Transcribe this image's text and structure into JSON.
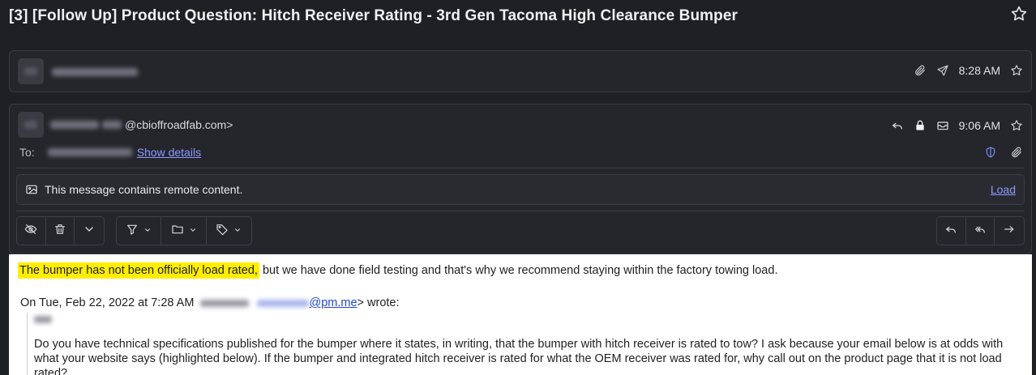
{
  "subject": "[3] [Follow Up] Product Question: Hitch Receiver Rating - 3rd Gen Tacoma High Clearance Bumper",
  "collapsed_message": {
    "time": "8:28 AM"
  },
  "expanded_message": {
    "sender_email_suffix": "@cbioffroadfab.com>",
    "time": "9:06 AM",
    "to_label": "To:",
    "show_details": "Show details"
  },
  "remote_content": {
    "text": "This message contains remote content.",
    "load_label": "Load"
  },
  "body": {
    "highlighted": "The bumper has not been officially load rated,",
    "rest": " but we have done field testing and that's why we recommend staying within the factory towing load.",
    "wrote_prefix": "On Tue, Feb 22, 2022 at 7:28 AM",
    "wrote_email": "@pm.me",
    "wrote_suffix": "> wrote:",
    "quote_text": "Do you have technical specifications published for the bumper where it states, in writing, that the bumper with hitch receiver is rated to tow? I ask because your email below is at odds with what your website says (highlighted below). If the bumper and integrated hitch receiver is rated for what the OEM receiver was rated for, why call out on the product page that it is not load rated?"
  },
  "colors": {
    "background": "#1f2025",
    "card": "#25262c",
    "link": "#8c98ff",
    "highlight": "#ffee00"
  },
  "icons": [
    "star-icon",
    "paperclip-icon",
    "send-icon",
    "reply-icon",
    "lock-icon",
    "envelope-icon",
    "shield-icon",
    "image-icon",
    "eye-off-icon",
    "trash-icon",
    "chevron-down-icon",
    "filter-icon",
    "folder-icon",
    "tag-icon",
    "reply-all-icon",
    "forward-icon"
  ]
}
